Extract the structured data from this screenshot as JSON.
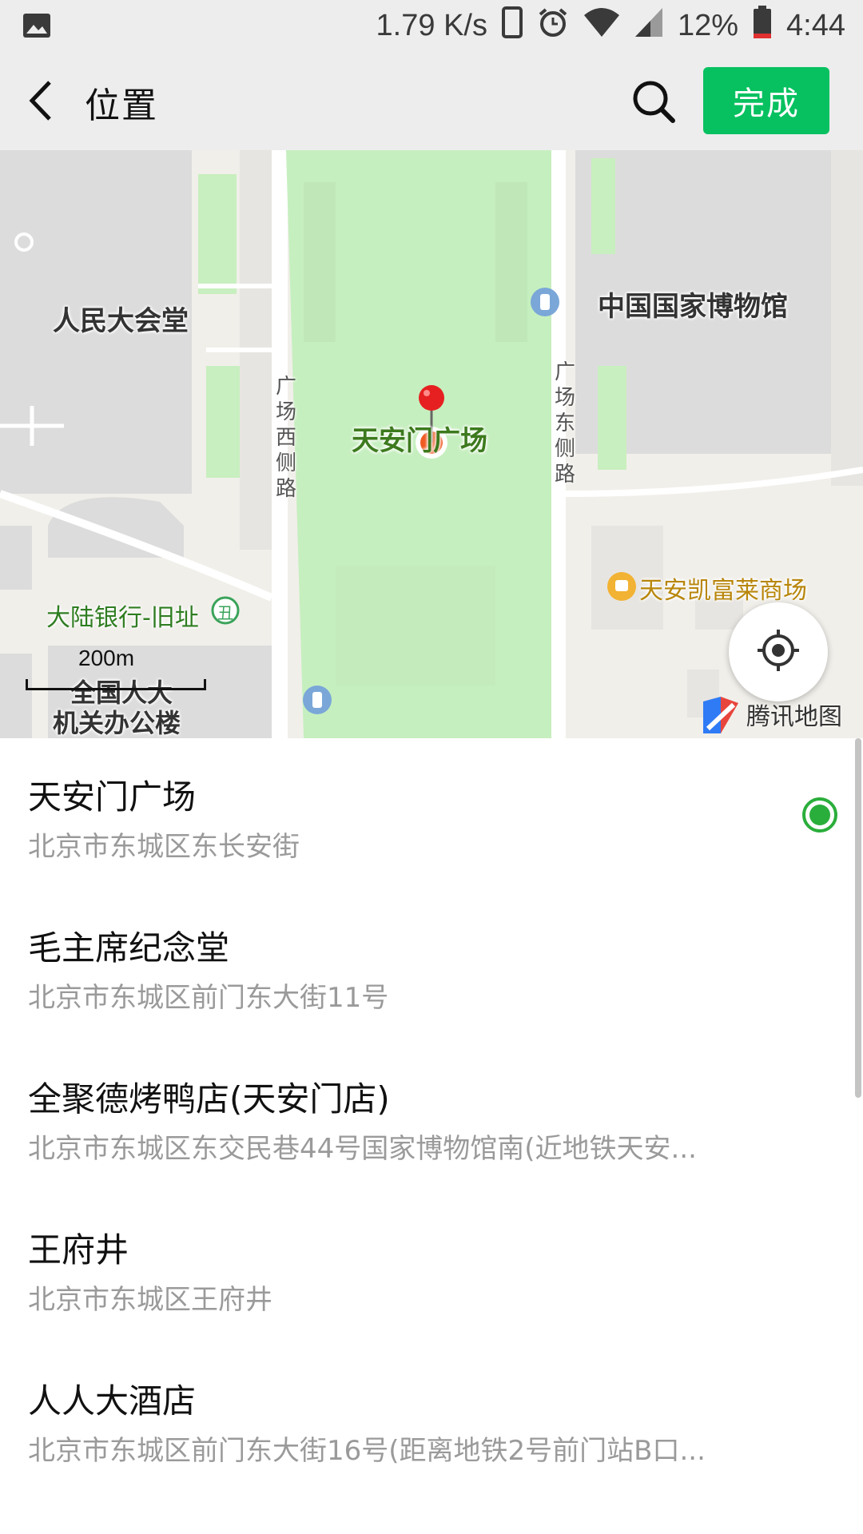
{
  "status_bar": {
    "network_speed": "1.79 K/s",
    "battery_percent": "12%",
    "time": "4:44",
    "icons": [
      "image-icon",
      "phone-icon",
      "alarm-icon",
      "wifi-icon",
      "signal-icon",
      "battery-icon"
    ]
  },
  "header": {
    "title": "位置",
    "done_label": "完成",
    "accent_color": "#07c160"
  },
  "map": {
    "labels": {
      "great_hall": "人民大会堂",
      "national_museum": "中国国家博物馆",
      "square": "天安门广场",
      "west_road": "广场西侧路",
      "east_road": "广场东侧路",
      "mall": "天安凯富莱商场",
      "bank": "大陆银行-旧址",
      "npc_office_1": "全国人大",
      "npc_office_2": "机关办公楼"
    },
    "scale": "200m",
    "provider": "腾讯地图"
  },
  "locations": [
    {
      "name": "天安门广场",
      "address": "北京市东城区东长安街",
      "selected": true
    },
    {
      "name": "毛主席纪念堂",
      "address": "北京市东城区前门东大街11号",
      "selected": false
    },
    {
      "name": "全聚德烤鸭店(天安门店)",
      "address": "北京市东城区东交民巷44号国家博物馆南(近地铁天安...",
      "selected": false
    },
    {
      "name": "王府井",
      "address": "北京市东城区王府井",
      "selected": false
    },
    {
      "name": "人人大酒店",
      "address": "北京市东城区前门东大街16号(距离地铁2号前门站B口...",
      "selected": false
    }
  ]
}
